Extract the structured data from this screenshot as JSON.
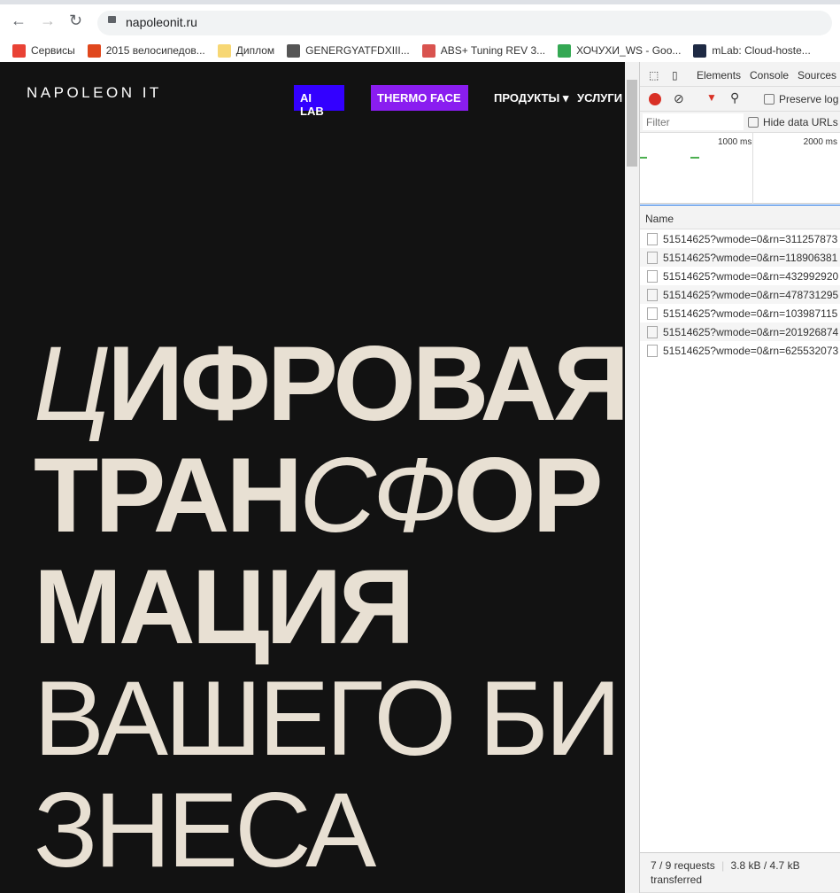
{
  "browser": {
    "url": "napoleonit.ru",
    "bookmarks": [
      {
        "label": "Сервисы",
        "color": "#e94235"
      },
      {
        "label": "2015 велосипедов...",
        "color": "#e0471d"
      },
      {
        "label": "Диплом",
        "color": "#f7d774"
      },
      {
        "label": "GENERGYATFDXIII...",
        "color": "#555555"
      },
      {
        "label": "ABS+ Tuning REV 3...",
        "color": "#d9534f"
      },
      {
        "label": "ХОЧУХИ_WS - Goo...",
        "color": "#34a853"
      },
      {
        "label": "mLab: Cloud-hoste...",
        "color": "#1e2a44"
      }
    ]
  },
  "site": {
    "logo": "NAPOLEON IT",
    "nav": {
      "ai_lab": "AI LAB",
      "thermo": "THERMO FACE",
      "products": "ПРОДУКТЫ ▾",
      "services": "УСЛУГИ"
    },
    "hero": {
      "l1a": "Ц",
      "l1b": "ИФРОВАЯ",
      "l2a": "ТРАН",
      "l2b": "СФ",
      "l2c": "ОРМАЦИЯ",
      "l3": "ВАШЕГО БИЗНЕСА"
    },
    "colors": {
      "ai_lab": "#3300ff",
      "thermo": "#8a1df0",
      "bg": "#121212"
    }
  },
  "devtools": {
    "tabs": [
      "Elements",
      "Console",
      "Sources"
    ],
    "preserve_log": "Preserve log",
    "filter_placeholder": "Filter",
    "hide": "Hide data URLs",
    "t1": "1000 ms",
    "t2": "2000 ms",
    "name_header": "Name",
    "requests": [
      "51514625?wmode=0&rn=311257873",
      "51514625?wmode=0&rn=118906381",
      "51514625?wmode=0&rn=432992920",
      "51514625?wmode=0&rn=478731295",
      "51514625?wmode=0&rn=103987115",
      "51514625?wmode=0&rn=201926874",
      "51514625?wmode=0&rn=625532073"
    ],
    "status_requests": "7 / 9 requests",
    "status_size": "3.8 kB / 4.7 kB transferred"
  }
}
